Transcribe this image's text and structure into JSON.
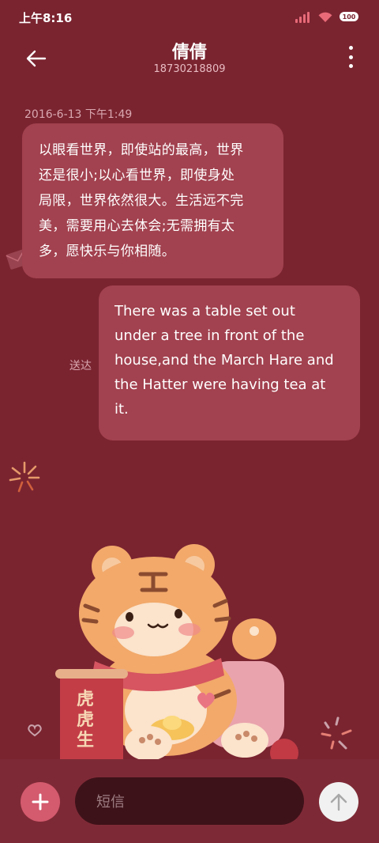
{
  "status_bar": {
    "time": "上午8:16",
    "battery": "100",
    "icons": [
      "signal-icon",
      "wifi-icon",
      "battery-icon"
    ]
  },
  "header": {
    "contact_name": "倩倩",
    "phone_number": "18730218809",
    "back_icon": "arrow-left-icon",
    "more_icon": "more-vertical-icon"
  },
  "conversation": {
    "timestamp": "2016-6-13 下午1:49",
    "messages": [
      {
        "direction": "incoming",
        "lines": [
          "以眼看世界，即使站的最高，世界",
          "还是很小;以心看世界，即使身处",
          "局限，世界依然很大。生活远不完",
          "美，需要用心去体会;无需拥有太",
          "多，愿快乐与你相随。"
        ]
      },
      {
        "direction": "outgoing",
        "status": "送达",
        "lines": [
          "There was a table set out",
          "under a tree in front of the",
          "house,and the March Hare and",
          "the Hatter were having tea at",
          "it."
        ]
      }
    ]
  },
  "composer": {
    "placeholder": "短信",
    "add_icon": "plus-icon",
    "send_icon": "arrow-up-icon"
  },
  "theme": {
    "background": "#7a2430",
    "bubble": "#a2414f",
    "accent": "#d45a6e"
  },
  "background_art": {
    "scroll_text": "虎虎生"
  }
}
